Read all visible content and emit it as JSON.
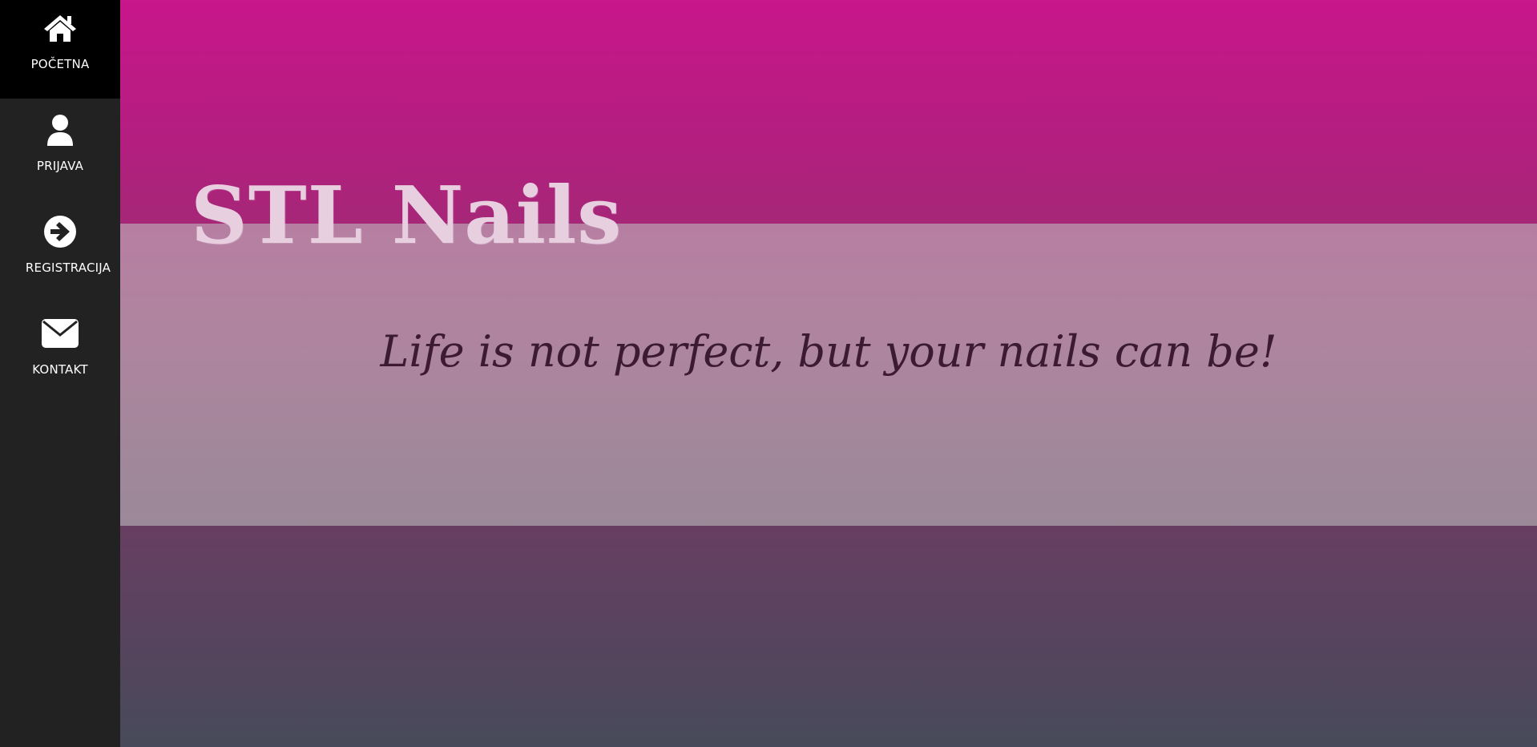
{
  "sidebar": {
    "items": [
      {
        "label": "POČETNA",
        "icon": "home-icon",
        "active": true
      },
      {
        "label": "PRIJAVA",
        "icon": "user-icon",
        "active": false
      },
      {
        "label": "REGISTRACIJA",
        "icon": "arrow-right-circle-icon",
        "active": false
      },
      {
        "label": "KONTAKT",
        "icon": "envelope-icon",
        "active": false
      }
    ]
  },
  "hero": {
    "brand": "STL Nails",
    "tagline": "Life is not perfect, but your nails can be!"
  },
  "colors": {
    "sidebar_bg": "#222222",
    "active_item_bg": "#000000",
    "gradient_top": "#c8168b",
    "gradient_bottom": "#474a5a",
    "brand_text": "#e8cfe0",
    "tagline_text": "#3b1a32"
  }
}
